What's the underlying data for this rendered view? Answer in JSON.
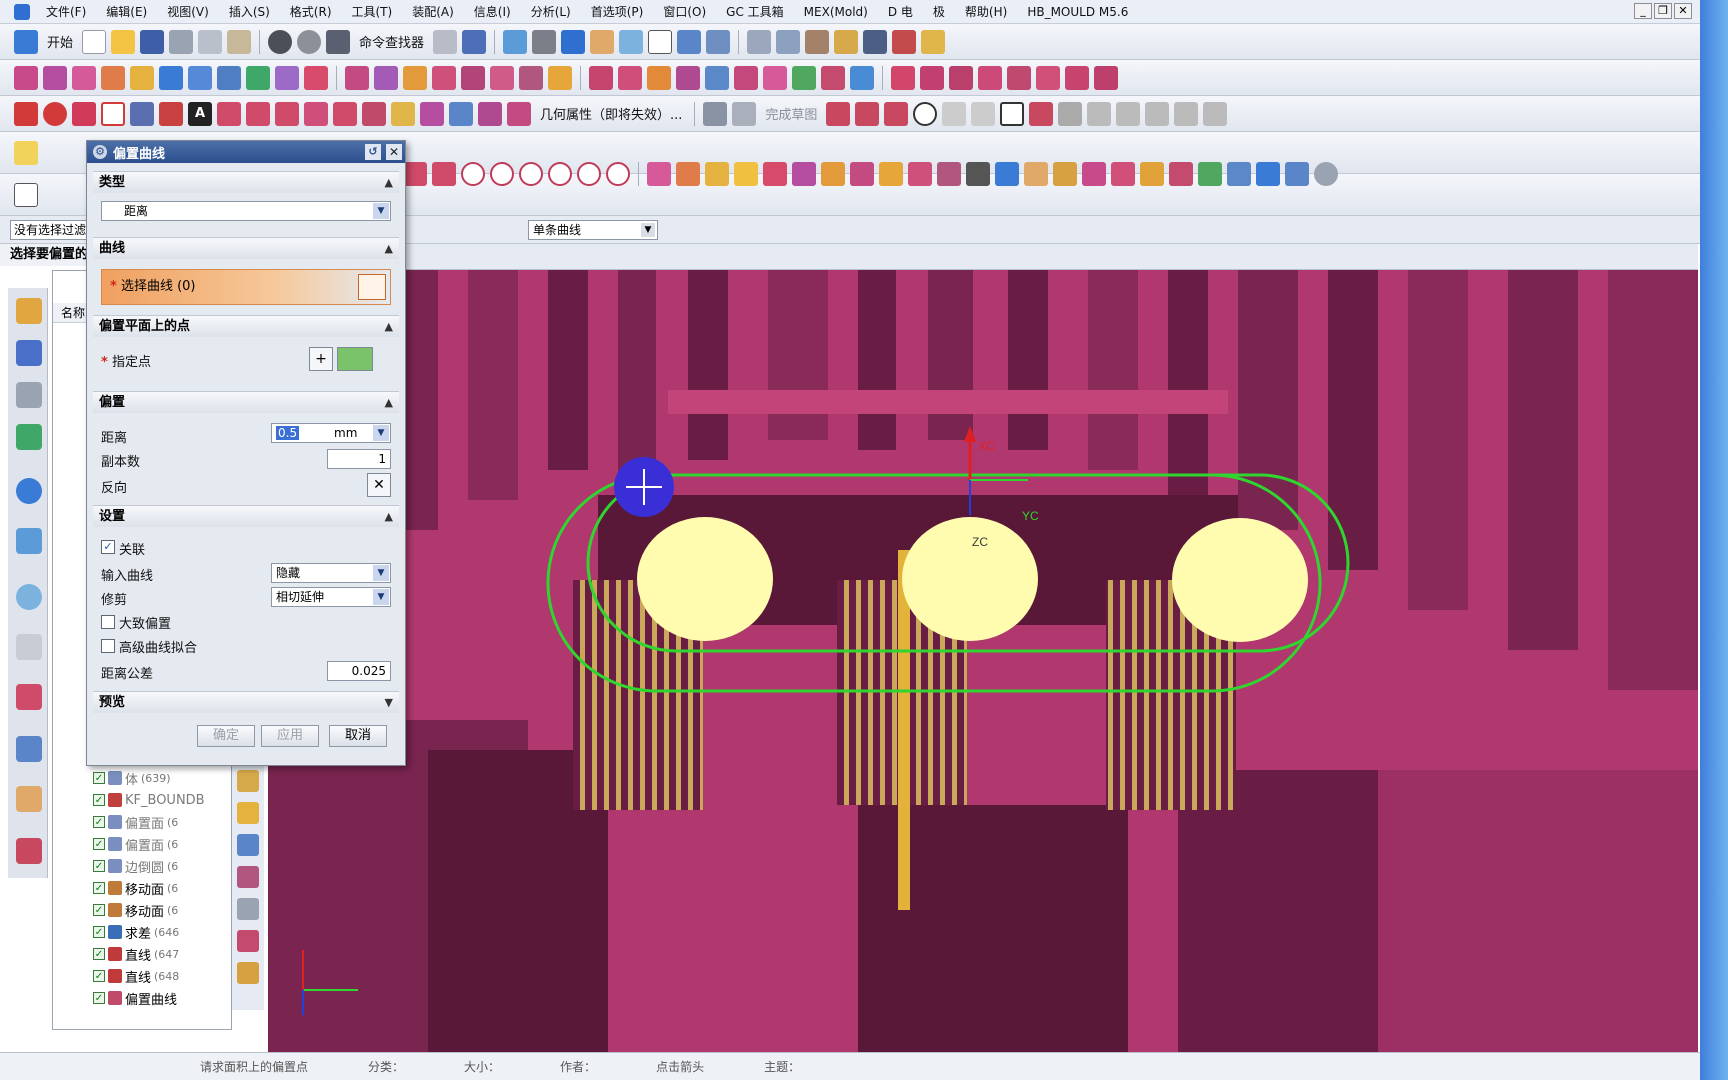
{
  "menubar": {
    "items": [
      "文件(F)",
      "编辑(E)",
      "视图(V)",
      "插入(S)",
      "格式(R)",
      "工具(T)",
      "装配(A)",
      "信息(I)",
      "分析(L)",
      "首选项(P)",
      "窗口(O)",
      "GC 工具箱",
      "MEX(Mold)",
      "D 电",
      "极",
      "帮助(H)",
      "HB_MOULD M5.6"
    ]
  },
  "toolbar1": {
    "start_label": "开始",
    "command_finder_label": "命令查找器"
  },
  "toolbar3": {
    "geometry_label": "几何属性（即将失效）...",
    "finish_sketch_label": "完成草图"
  },
  "selection_bar": {
    "filter_value": "没有选择过滤器",
    "curve_rule_value": "单条曲线"
  },
  "prompt": {
    "text": "选择要偏置的"
  },
  "nav_panel": {
    "column_header": "名称",
    "items": [
      {
        "label": "体",
        "count": "(639)",
        "checked": "✓",
        "dim": true
      },
      {
        "label": "KF_BOUNDB",
        "count": "",
        "checked": "✓",
        "dim": true
      },
      {
        "label": "偏置面",
        "count": "(6",
        "checked": "✓",
        "dim": true
      },
      {
        "label": "偏置面",
        "count": "(6",
        "checked": "✓",
        "dim": true
      },
      {
        "label": "边倒圆",
        "count": "(6",
        "checked": "✓",
        "dim": true
      },
      {
        "label": "移动面",
        "count": "(6",
        "checked": "✓",
        "dim": false
      },
      {
        "label": "移动面",
        "count": "(6",
        "checked": "✓",
        "dim": false
      },
      {
        "label": "求差",
        "count": "(646",
        "checked": "✓",
        "dim": false
      },
      {
        "label": "直线",
        "count": "(647",
        "checked": "✓",
        "dim": false
      },
      {
        "label": "直线",
        "count": "(648",
        "checked": "✓",
        "dim": false
      },
      {
        "label": "偏置曲线",
        "count": "",
        "checked": "✓",
        "dim": false
      }
    ]
  },
  "dialog": {
    "title": "偏置曲线",
    "groups": {
      "type": "类型",
      "curve": "曲线",
      "point": "偏置平面上的点",
      "offset": "偏置",
      "settings": "设置",
      "preview": "预览"
    },
    "type_value": "距离",
    "select_curve_label": "选择曲线 (0)",
    "specify_point_label": "指定点",
    "distance_label": "距离",
    "distance_value": "0.5",
    "distance_unit": "mm",
    "copies_label": "副本数",
    "copies_value": "1",
    "reverse_label": "反向",
    "associative_label": "关联",
    "associative_checked": "✓",
    "input_curve_label": "输入曲线",
    "input_curve_value": "隐藏",
    "trim_label": "修剪",
    "trim_value": "相切延伸",
    "rough_offset_label": "大致偏置",
    "advanced_fit_label": "高级曲线拟合",
    "tolerance_label": "距离公差",
    "tolerance_value": "0.025",
    "ok_label": "确定",
    "apply_label": "应用",
    "cancel_label": "取消"
  },
  "viewport": {
    "axis_xc": "XC",
    "axis_yc": "YC",
    "axis_zc": "ZC",
    "colors": {
      "model": "#b0386e",
      "shadow": "#6a1d44",
      "circle_fill": "#fffcb0",
      "curve": "#2ed62e",
      "selection": "#3a2fd6"
    }
  },
  "statusbar": {
    "items": [
      "请求面积上的偏置点",
      "分类：",
      "大小：",
      "作者：",
      "点击箭头",
      "主题："
    ]
  }
}
